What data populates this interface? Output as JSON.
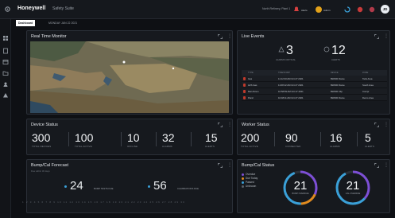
{
  "header": {
    "logo": "Honeywell",
    "app_title": "Safety Suite",
    "site": "North Refinery, Plant 1",
    "notif_label": "Alerts",
    "user_label": "Admin",
    "avatar": "JD",
    "accent": "#e3a21a"
  },
  "tabs": [
    {
      "label": "Dashboard",
      "active": true
    },
    {
      "label": "MONDAY JAN 22 2021",
      "active": false
    }
  ],
  "sidebar": [
    {
      "icon": "grid-icon"
    },
    {
      "icon": "document-icon"
    },
    {
      "icon": "calendar-icon"
    },
    {
      "icon": "folder-icon"
    },
    {
      "icon": "people-icon"
    },
    {
      "icon": "user-icon"
    }
  ],
  "realtime": {
    "title": "Real Time Monitor"
  },
  "live_events": {
    "title": "Live Events",
    "alarms_value": "3",
    "alarms_label": "ALARMS CRITICAL",
    "alerts_value": "12",
    "alerts_label": "ALERTS",
    "columns": [
      "TYPE",
      "TIMESTAMP",
      "DEVICE",
      "ZONE"
    ],
    "rows": [
      {
        "type": "Gas",
        "time": "11:12:33 AM Oct 27 2021",
        "device": "BW200 Flame",
        "zone": "Tank Area"
      },
      {
        "type": "H2S Gas",
        "time": "11:08:12 AM Oct 27 2021",
        "device": "BW200 Flame",
        "zone": "South Area"
      },
      {
        "type": "Man Down",
        "time": "10:58:59 AM Oct 27 2021",
        "device": "BW200 Clip",
        "zone": "Compr"
      },
      {
        "type": "Panic",
        "time": "10:48:11 AM Oct 27 2021",
        "device": "BW200 Flame",
        "zone": "Demo Area"
      }
    ]
  },
  "device_status": {
    "title": "Device Status",
    "stats": [
      {
        "value": "300",
        "label": "TOTAL DEVICES"
      },
      {
        "value": "100",
        "label": "TOTAL ACTIVE"
      },
      {
        "value": "10",
        "label": "OFFLINE"
      },
      {
        "value": "32",
        "label": "ALARMS"
      },
      {
        "value": "15",
        "label": "ALERTS"
      }
    ]
  },
  "worker_status": {
    "title": "Worker Status",
    "stats": [
      {
        "value": "200",
        "label": "TOTAL ACTIVE"
      },
      {
        "value": "90",
        "label": "CONNECTED"
      },
      {
        "value": "16",
        "label": "ALARMS"
      },
      {
        "value": "5",
        "label": "ALERTS"
      }
    ]
  },
  "forecast": {
    "title": "Bump/Cal Forecast",
    "subtitle": "Due within 30 days",
    "bump_value": "24",
    "bump_label": "BUMP TESTS DUE",
    "cal_value": "56",
    "cal_label": "CALIBRATIONS DUE",
    "days": "1 2 3 4 5 6 7 8 9 10 11 12 13 14 15 16 17 18 19 20 21 22 23 24 25 26 27 28 29 30"
  },
  "bump_status": {
    "title": "Bump/Cal Status",
    "legend": [
      {
        "label": "Overdue",
        "color": "#7d4fd6"
      },
      {
        "label": "Due Today",
        "color": "#e08a1e"
      },
      {
        "label": "Passed",
        "color": "#3aa0d8"
      },
      {
        "label": "Unknown",
        "color": "#5a6068"
      }
    ],
    "ring1_value": "21",
    "ring1_label": "BUMP OVERDUE",
    "ring2_value": "21",
    "ring2_label": "CAL OVERDUE"
  }
}
